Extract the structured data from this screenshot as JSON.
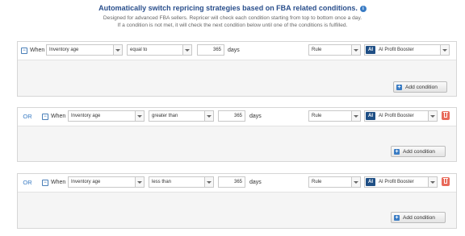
{
  "header": {
    "title": "Automatically switch repricing strategies based on FBA related conditions.",
    "info_icon": "i",
    "desc_line1": "Designed for advanced FBA sellers. Repricer will check each condition starting from top to bottom once a day.",
    "desc_line2": "If a condition is not met, it will check the next condition below until one of the conditions is fulfilled."
  },
  "conditions": [
    {
      "prefix": "",
      "when_label": "When",
      "field": "Inventory age",
      "operator": "equal to",
      "value": "365",
      "unit": "days",
      "type": "Rule",
      "ai_badge": "AI",
      "strategy": "AI Profit Booster",
      "add_label": "Add condition"
    },
    {
      "prefix": "OR",
      "when_label": "When",
      "field": "Inventory age",
      "operator": "greater than",
      "value": "365",
      "unit": "days",
      "type": "Rule",
      "ai_badge": "AI",
      "strategy": "AI Profit Booster",
      "add_label": "Add condition"
    },
    {
      "prefix": "OR",
      "when_label": "When",
      "field": "Inventory age",
      "operator": "less than",
      "value": "365",
      "unit": "days",
      "type": "Rule",
      "ai_badge": "AI",
      "strategy": "AI Profit Booster",
      "add_label": "Add condition"
    }
  ],
  "colors": {
    "title": "#2a4f8c",
    "accent": "#3a7cc4",
    "ai_badge": "#1f4f85",
    "delete": "#e86a5a",
    "panel": "#f5f5f5"
  },
  "icons": {
    "collapse": "collapse-icon",
    "dropdown": "chevron-down-icon",
    "delete": "trash-icon",
    "add": "plus-icon",
    "info": "info-icon"
  }
}
